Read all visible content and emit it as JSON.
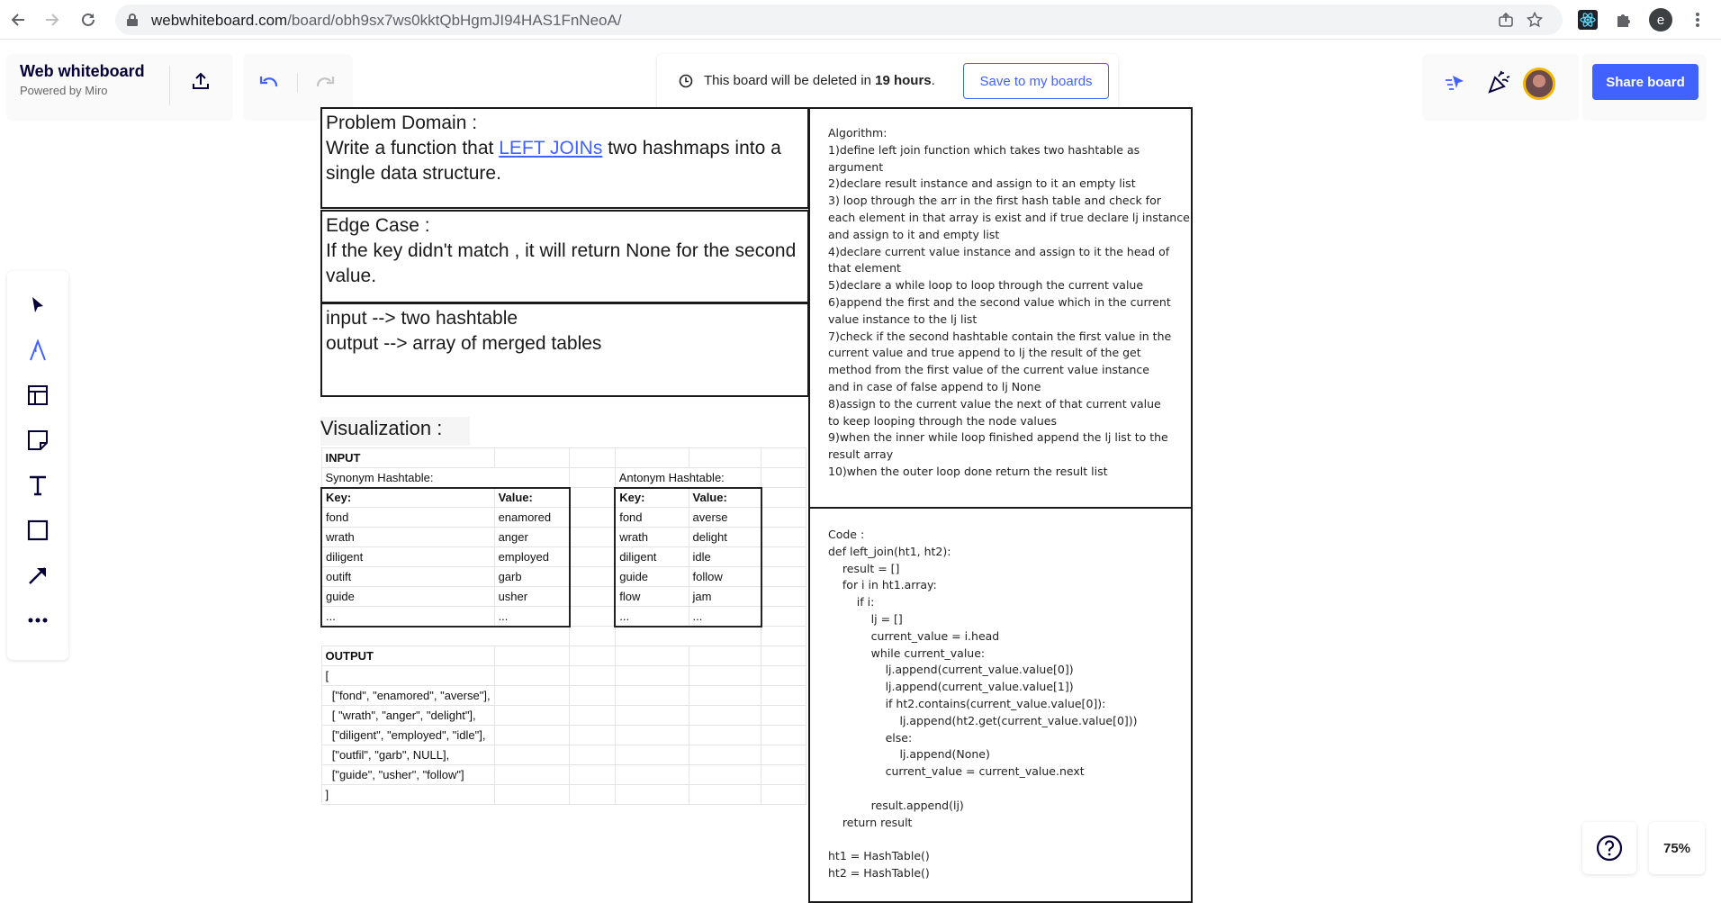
{
  "browser": {
    "url_host": "webwhiteboard.com",
    "url_path": "/board/obh9sx7ws0kktQbHgmJI94HAS1FnNeoA/",
    "profile_initial": "e"
  },
  "brand": {
    "title": "Web whiteboard",
    "subtitle": "Powered by Miro"
  },
  "notice": {
    "prefix": "This board will be deleted in ",
    "hours": "19 hours",
    "suffix": ".",
    "save_label": "Save to my boards"
  },
  "header": {
    "share_label": "Share board"
  },
  "board": {
    "problem": {
      "heading": "Problem Domain :",
      "line_before": "Write a function that ",
      "link": "LEFT JOINs",
      "line_after": " two hashmaps into a single data structure."
    },
    "edge": {
      "heading": "Edge Case :",
      "text": "If the key didn't match , it will return None for the second value."
    },
    "io": {
      "input": "input --> two hashtable",
      "output": "output --> array of merged tables"
    },
    "algorithm": "Algorithm:\n1)define left join function which takes two hashtable as\nargument\n2)declare result instance and assign to it an empty list\n3) loop through the arr in the first hash table and check for\neach element in that array is exist and if true declare lj instance\nand assign to it and empty list\n4)declare current value instance and assign to it the head of\nthat element\n5)declare a while loop to loop through the current value\n6)append the first and the second value which in the current\nvalue instance to the lj list\n7)check if the second hashtable contain the first value in the\ncurrent value and true append to lj the result of the get\nmethod from the first value of the current value instance\nand in case of false append to lj None\n8)assign to the current value the next of that current value\nto keep looping through the node values\n9)when the inner while loop finished append the lj list to the\nresult array\n10)when the outer loop done return the result list",
    "code": "Code :\ndef left_join(ht1, ht2):\n    result = []\n    for i in ht1.array:\n        if i:\n            lj = []\n            current_value = i.head\n            while current_value:\n                lj.append(current_value.value[0])\n                lj.append(current_value.value[1])\n                if ht2.contains(current_value.value[0]):\n                    lj.append(ht2.get(current_value.value[0]))\n                else:\n                    lj.append(None)\n                current_value = current_value.next\n\n            result.append(lj)\n    return result\n\nht1 = HashTable()\nht2 = HashTable()",
    "viz_title": "Visualization :"
  },
  "sheet": {
    "input_label": "INPUT",
    "synonym_title": "Synonym Hashtable:",
    "antonym_title": "Antonym Hashtable:",
    "key_header": "Key:",
    "value_header": "Value:",
    "synonym_rows": [
      [
        "fond",
        "enamored"
      ],
      [
        "wrath",
        "anger"
      ],
      [
        "diligent",
        "employed"
      ],
      [
        "outift",
        "garb"
      ],
      [
        "guide",
        "usher"
      ],
      [
        "...",
        "..."
      ]
    ],
    "antonym_rows": [
      [
        "fond",
        "averse"
      ],
      [
        "wrath",
        "delight"
      ],
      [
        "diligent",
        "idle"
      ],
      [
        "guide",
        "follow"
      ],
      [
        "flow",
        "jam"
      ],
      [
        "...",
        "..."
      ]
    ],
    "output_label": "OUTPUT",
    "output_lines": [
      "[",
      "  [\"fond\", \"enamored\", \"averse\"],",
      "  [ \"wrath\", \"anger\", \"delight\"],",
      "  [\"diligent\", \"employed\", \"idle\"],",
      "  [\"outfil\", \"garb\", NULL],",
      "  [\"guide\", \"usher\", \"follow\"]",
      "]"
    ]
  },
  "footer": {
    "zoom": "75%"
  },
  "colors": {
    "accent": "#4262ff",
    "brand_dark": "#050038"
  }
}
